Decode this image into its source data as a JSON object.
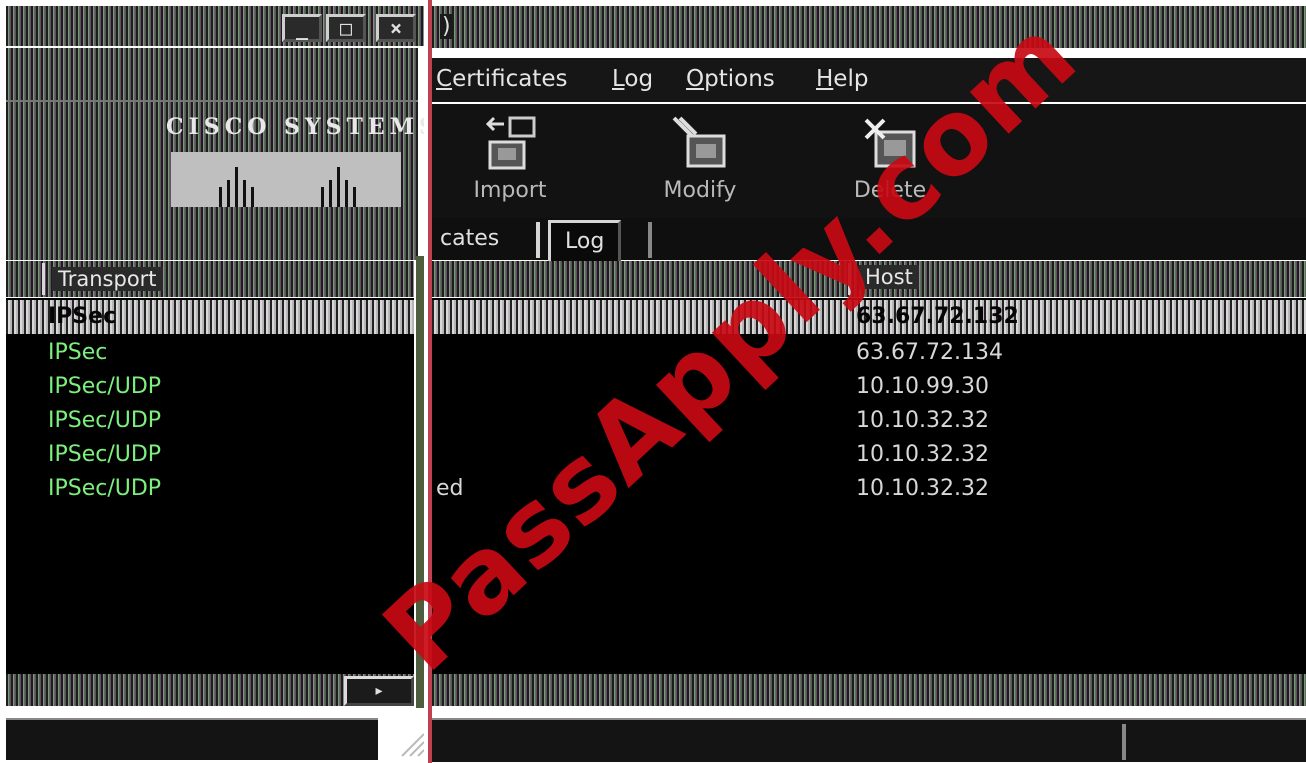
{
  "left_window": {
    "buttons": {
      "minimize": "_",
      "maximize": "□",
      "close": "×"
    },
    "logo_text": "CISCO SYSTEMS",
    "column_header": "Transport",
    "rows": [
      "IPSec",
      "IPSec",
      "IPSec/UDP",
      "IPSec/UDP",
      "IPSec/UDP",
      "IPSec/UDP"
    ]
  },
  "right_window": {
    "title_fragment": ")",
    "menu": [
      "Certificates",
      "Log",
      "Options",
      "Help"
    ],
    "menu_mnemonics": [
      "C",
      "L",
      "O",
      "H"
    ],
    "toolbar": [
      {
        "label": "Import",
        "icon": "import-certificate-icon"
      },
      {
        "label": "Modify",
        "icon": "modify-certificate-icon"
      },
      {
        "label": "Delete",
        "icon": "delete-certificate-icon"
      }
    ],
    "tabs": [
      "cates",
      "Log"
    ],
    "column_header": "Host",
    "status_fragment": "ed",
    "hosts": [
      "63.67.72.132",
      "63.67.72.134",
      "10.10.99.30",
      "10.10.32.32",
      "10.10.32.32",
      "10.10.32.32"
    ],
    "selected_row": 0
  },
  "watermark": "PassApply.com",
  "colors": {
    "transport_text": "#7cf07c",
    "host_text": "#d8d8d8",
    "watermark": "#c80a14"
  }
}
